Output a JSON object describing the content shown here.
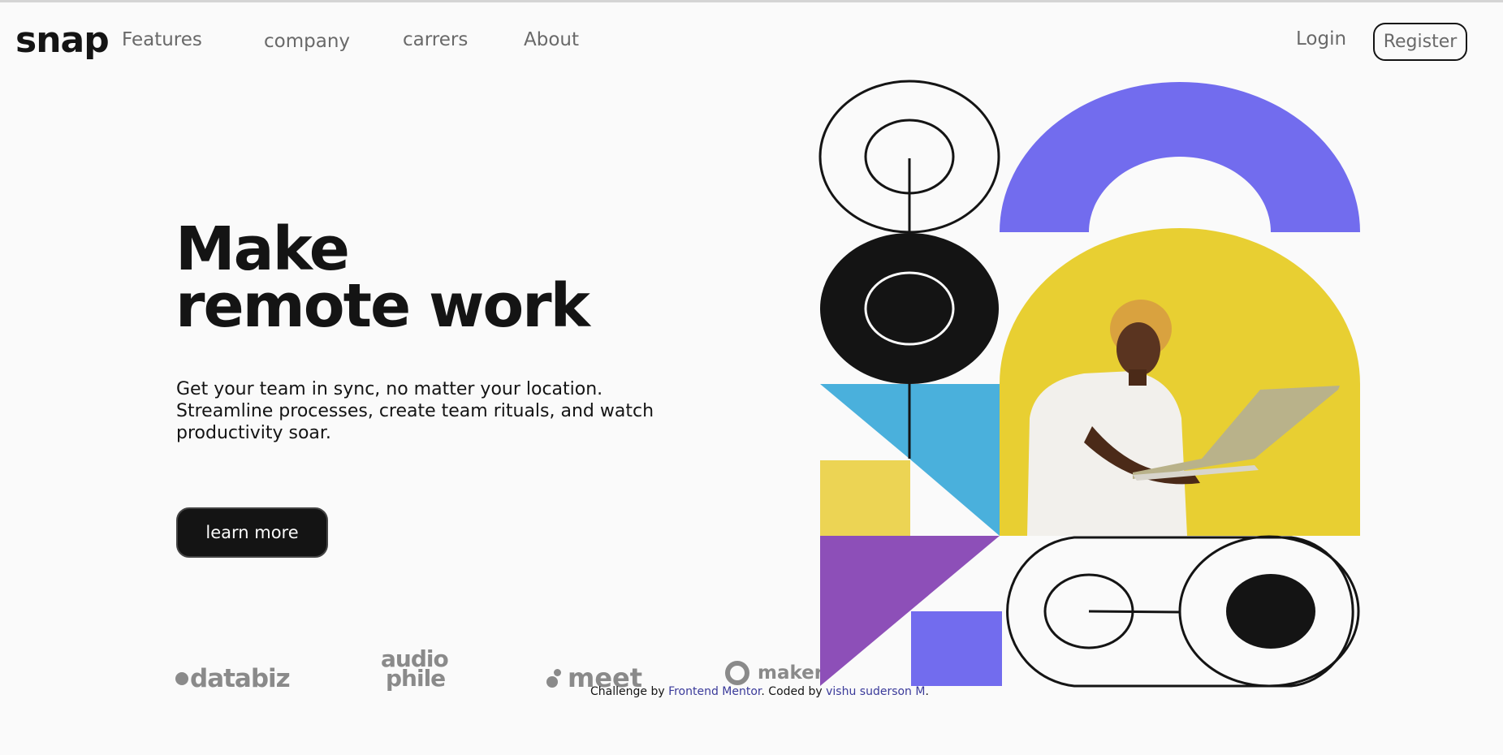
{
  "header": {
    "logo": "snap",
    "nav": [
      "Features",
      "company",
      "carrers",
      "About"
    ],
    "login": "Login",
    "register": "Register"
  },
  "hero": {
    "headline_line1": "Make",
    "headline_line2": "remote work",
    "subtext": "Get your team in sync, no matter your location. Streamline processes, create team rituals, and watch productivity soar.",
    "cta": "learn more"
  },
  "partners": {
    "databiz": "databiz",
    "audiophile_line1": "audio",
    "audiophile_line2": "phile",
    "meet": "meet",
    "maker": "maker"
  },
  "attribution": {
    "prefix": "Challenge by ",
    "mentor": "Frontend Mentor",
    "middle": ". Coded by ",
    "author": "vishu suderson M",
    "suffix": "."
  },
  "colors": {
    "ink": "#141414",
    "violet": "#726cee",
    "yellow": "#e8cf32",
    "sky": "#4ab0dc",
    "mustard": "#ecd454",
    "purple": "#8d4fb8"
  }
}
